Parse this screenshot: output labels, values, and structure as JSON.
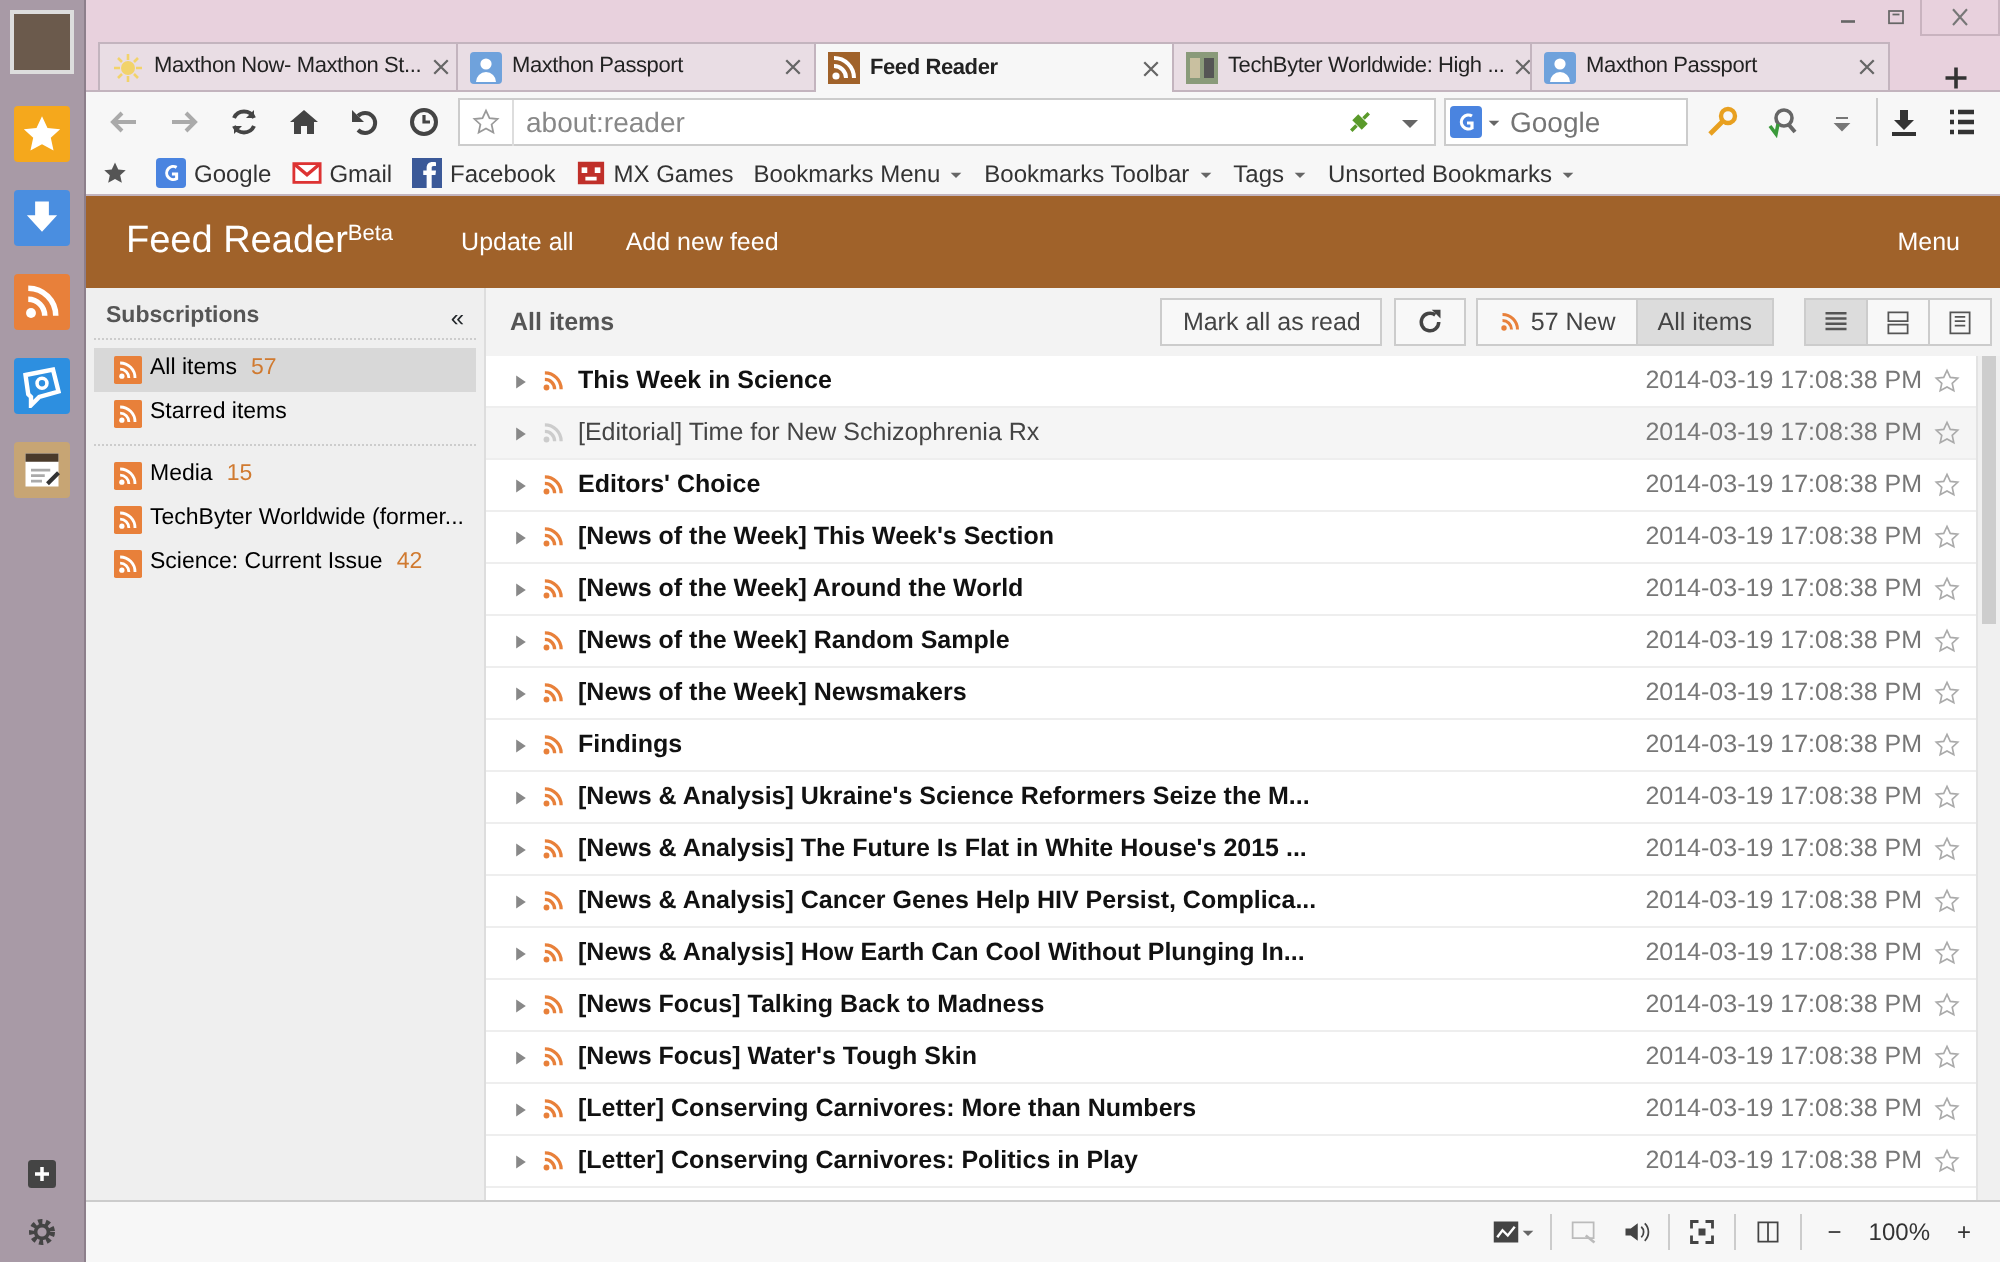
{
  "tabs": [
    {
      "label": "Maxthon Now- Maxthon St...",
      "kind": "sun",
      "selected": false
    },
    {
      "label": "Maxthon Passport",
      "kind": "person",
      "selected": false
    },
    {
      "label": "Feed Reader",
      "kind": "rss",
      "selected": true
    },
    {
      "label": "TechByter Worldwide: High ...",
      "kind": "site",
      "selected": false
    },
    {
      "label": "Maxthon Passport",
      "kind": "person",
      "selected": false
    }
  ],
  "address": {
    "value": "about:reader"
  },
  "search": {
    "placeholder": "Google"
  },
  "bookmarks": [
    {
      "label": "Google",
      "kind": "google"
    },
    {
      "label": "Gmail",
      "kind": "gmail"
    },
    {
      "label": "Facebook",
      "kind": "facebook"
    },
    {
      "label": "MX Games",
      "kind": "games"
    },
    {
      "label": "Bookmarks Menu",
      "kind": "menu"
    },
    {
      "label": "Bookmarks Toolbar",
      "kind": "menu"
    },
    {
      "label": "Tags",
      "kind": "menu"
    },
    {
      "label": "Unsorted Bookmarks",
      "kind": "menu"
    }
  ],
  "reader": {
    "title": "Feed Reader",
    "badge": "Beta",
    "actions": [
      "Update all",
      "Add new feed"
    ],
    "menu": "Menu"
  },
  "sidebar": {
    "title": "Subscriptions",
    "collapse": "«",
    "groups": [
      [
        {
          "label": "All items",
          "count": "57",
          "selected": true
        },
        {
          "label": "Starred items",
          "selected": false
        }
      ],
      [
        {
          "label": "Media",
          "count": "15",
          "selected": false
        },
        {
          "label": "TechByter Worldwide (former...",
          "selected": false
        },
        {
          "label": "Science: Current Issue",
          "count": "42",
          "selected": false
        }
      ]
    ]
  },
  "list": {
    "title": "All items",
    "mark_all": "Mark all as read",
    "filters": [
      {
        "label": "57 New",
        "kind": "new",
        "selected": false
      },
      {
        "label": "All items",
        "kind": "all",
        "selected": true
      }
    ],
    "views": [
      {
        "kind": "list",
        "selected": true
      },
      {
        "kind": "cards",
        "selected": false
      },
      {
        "kind": "expanded",
        "selected": false
      }
    ],
    "items": [
      {
        "title": "This Week in Science",
        "date": "2014-03-19 17:08:38 PM",
        "read": false,
        "starred": false
      },
      {
        "title": "[Editorial] Time for New Schizophrenia Rx",
        "date": "2014-03-19 17:08:38 PM",
        "read": true,
        "starred": false
      },
      {
        "title": "Editors' Choice",
        "date": "2014-03-19 17:08:38 PM",
        "read": false,
        "starred": false
      },
      {
        "title": "[News of the Week] This Week's Section",
        "date": "2014-03-19 17:08:38 PM",
        "read": false,
        "starred": false
      },
      {
        "title": "[News of the Week] Around the World",
        "date": "2014-03-19 17:08:38 PM",
        "read": false,
        "starred": false
      },
      {
        "title": "[News of the Week] Random Sample",
        "date": "2014-03-19 17:08:38 PM",
        "read": false,
        "starred": false
      },
      {
        "title": "[News of the Week] Newsmakers",
        "date": "2014-03-19 17:08:38 PM",
        "read": false,
        "starred": false
      },
      {
        "title": "Findings",
        "date": "2014-03-19 17:08:38 PM",
        "read": false,
        "starred": false
      },
      {
        "title": "[News & Analysis] Ukraine's Science Reformers Seize the M...",
        "date": "2014-03-19 17:08:38 PM",
        "read": false,
        "starred": false
      },
      {
        "title": "[News & Analysis] The Future Is Flat in White House's 2015 ...",
        "date": "2014-03-19 17:08:38 PM",
        "read": false,
        "starred": false
      },
      {
        "title": "[News & Analysis] Cancer Genes Help HIV Persist, Complica...",
        "date": "2014-03-19 17:08:38 PM",
        "read": false,
        "starred": false
      },
      {
        "title": "[News & Analysis] How Earth Can Cool Without Plunging In...",
        "date": "2014-03-19 17:08:38 PM",
        "read": false,
        "starred": false
      },
      {
        "title": "[News Focus] Talking Back to Madness",
        "date": "2014-03-19 17:08:38 PM",
        "read": false,
        "starred": false
      },
      {
        "title": "[News Focus] Water's Tough Skin",
        "date": "2014-03-19 17:08:38 PM",
        "read": false,
        "starred": false
      },
      {
        "title": "[Letter] Conserving Carnivores: More than Numbers",
        "date": "2014-03-19 17:08:38 PM",
        "read": false,
        "starred": false
      },
      {
        "title": "[Letter] Conserving Carnivores: Politics in Play",
        "date": "2014-03-19 17:08:38 PM",
        "read": false,
        "starred": false
      }
    ]
  },
  "status_bar": {
    "zoom": "100%",
    "zoom_out": "−",
    "zoom_in": "+"
  }
}
